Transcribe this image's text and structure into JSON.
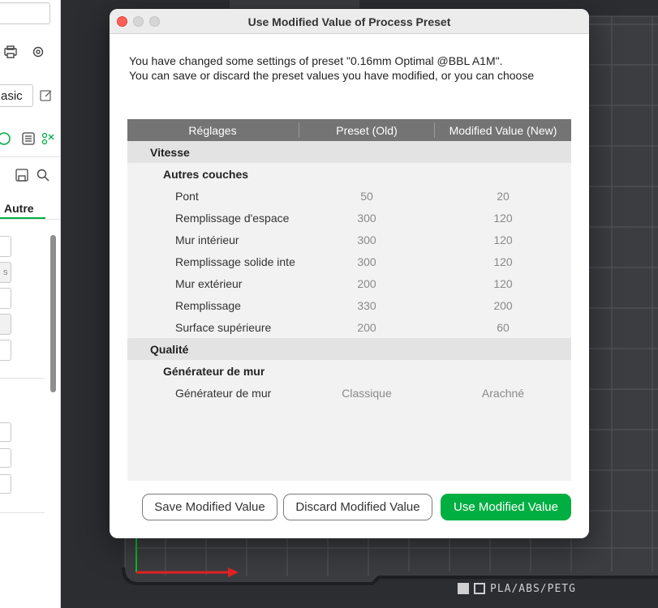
{
  "sidebar": {
    "preset_fragment": "asic",
    "tab_fragment": "Autre",
    "unit_fragment": "s"
  },
  "viewport": {
    "plate_label": "PLA/ABS/PETG"
  },
  "dialog": {
    "title": "Use Modified Value of Process Preset",
    "message_line1": "You have changed some settings of preset \"0.16mm Optimal @BBL A1M\".",
    "message_line2": "You can save or discard the preset values you have modified, or you can choose",
    "table": {
      "headers": [
        "Réglages",
        "Preset (Old)",
        "Modified Value (New)"
      ],
      "rows": [
        {
          "kind": "group",
          "label": "Vitesse"
        },
        {
          "kind": "subgroup",
          "label": "Autres couches"
        },
        {
          "kind": "item",
          "label": "Pont",
          "old": "50",
          "new": "20"
        },
        {
          "kind": "item",
          "label": "Remplissage d'espace",
          "old": "300",
          "new": "120"
        },
        {
          "kind": "item",
          "label": "Mur intérieur",
          "old": "300",
          "new": "120"
        },
        {
          "kind": "item",
          "label": "Remplissage solide inte",
          "old": "300",
          "new": "120"
        },
        {
          "kind": "item",
          "label": "Mur extérieur",
          "old": "200",
          "new": "120"
        },
        {
          "kind": "item",
          "label": "Remplissage",
          "old": "330",
          "new": "200"
        },
        {
          "kind": "item",
          "label": "Surface supérieure",
          "old": "200",
          "new": "60"
        },
        {
          "kind": "group",
          "label": "Qualité"
        },
        {
          "kind": "subgroup",
          "label": "Générateur de mur"
        },
        {
          "kind": "item",
          "label": "Générateur de mur",
          "old": "Classique",
          "new": "Arachné"
        }
      ]
    },
    "buttons": {
      "save": "Save Modified Value",
      "discard": "Discard Modified Value",
      "use": "Use Modified Value"
    }
  },
  "colors": {
    "accent": "#00ae42",
    "close_button": "#fe5f57",
    "table_header": "#747474"
  }
}
